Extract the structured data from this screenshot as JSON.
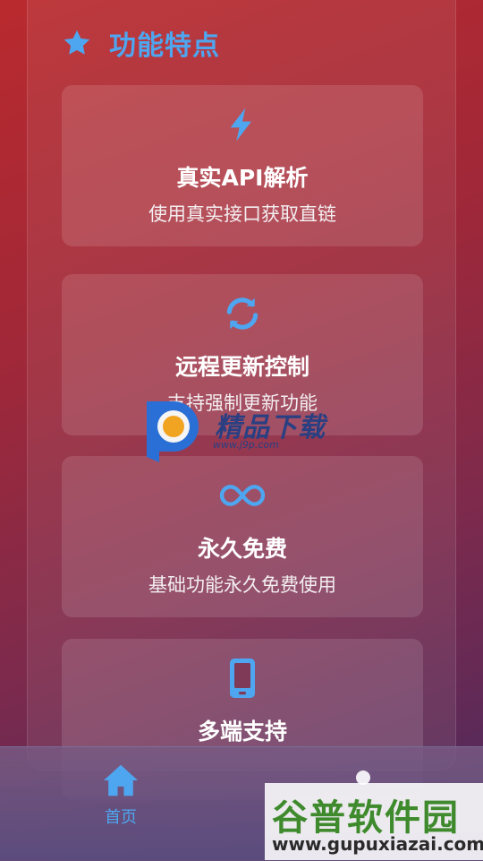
{
  "section": {
    "title": "功能特点",
    "icon": "star-icon"
  },
  "features": [
    {
      "icon": "lightning-icon",
      "title": "真实API解析",
      "desc": "使用真实接口获取直链"
    },
    {
      "icon": "refresh-icon",
      "title": "远程更新控制",
      "desc": "支持强制更新功能"
    },
    {
      "icon": "infinity-icon",
      "title": "永久免费",
      "desc": "基础功能永久免费使用"
    },
    {
      "icon": "phone-icon",
      "title": "多端支持",
      "desc": ""
    }
  ],
  "watermark": {
    "text": "精品下载",
    "url": "www.j9p.com"
  },
  "nav": {
    "home_label": "首页"
  },
  "corner_watermark": {
    "text": "谷普软件园",
    "url": "www.gupuxiazai.com"
  },
  "colors": {
    "accent": "#4ea6f0"
  }
}
